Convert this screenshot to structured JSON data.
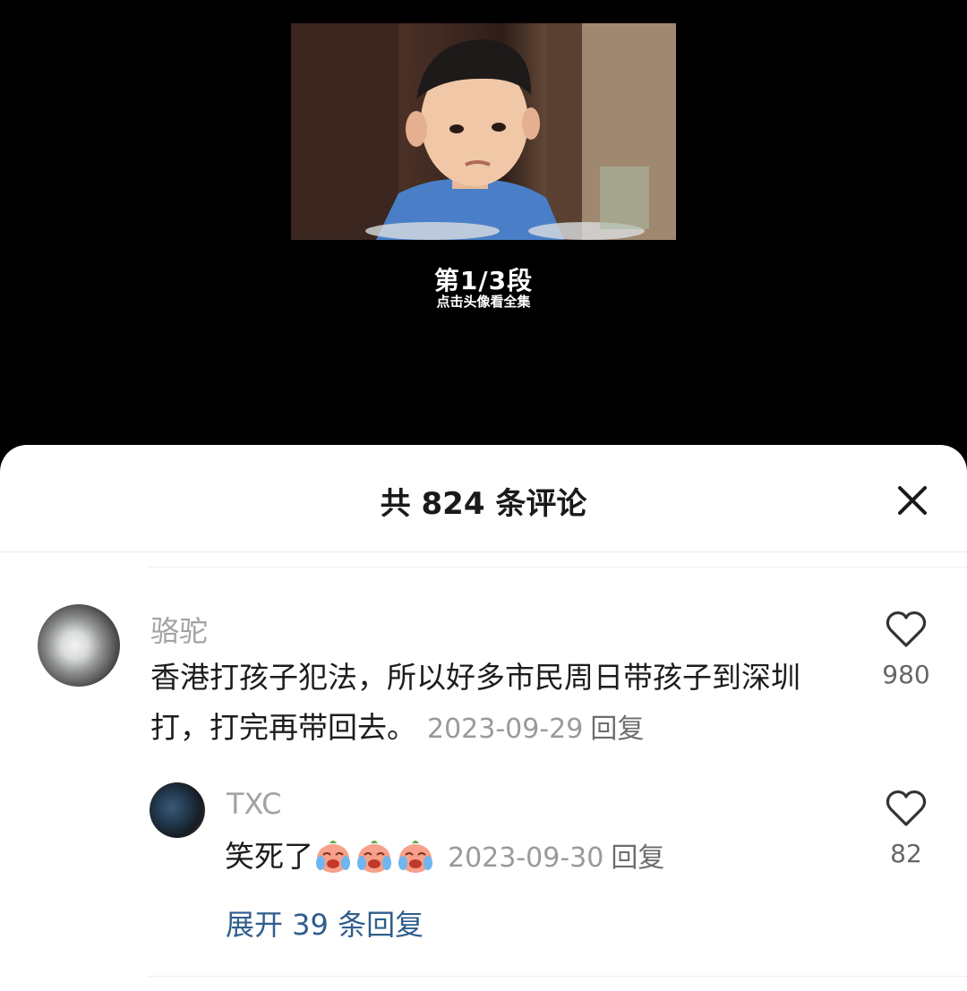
{
  "video": {
    "segment_label": "第1/3段",
    "segment_hint": "点击头像看全集"
  },
  "sheet": {
    "title": "共 824 条评论"
  },
  "comments": [
    {
      "username": "骆驼",
      "text": "香港打孩子犯法，所以好多市民周日带孩子到深圳打，打完再带回去。",
      "date": "2023-09-29",
      "reply_label": "回复",
      "likes": "980",
      "replies": [
        {
          "username": "TXC",
          "text": "笑死了",
          "emoji": [
            "laugh-cry-peach-emoji",
            "laugh-cry-peach-emoji",
            "laugh-cry-peach-emoji"
          ],
          "date": "2023-09-30",
          "reply_label": "回复",
          "likes": "82"
        }
      ],
      "expand_label": "展开 39 条回复"
    }
  ],
  "colors": {
    "background_video": "#000000",
    "sheet_background": "#ffffff",
    "username": "#a3a3a3",
    "link": "#2f5d8c"
  }
}
